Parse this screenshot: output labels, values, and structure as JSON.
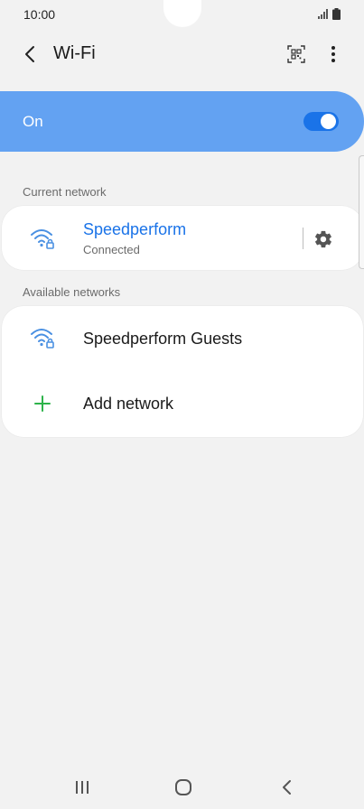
{
  "status_bar": {
    "time": "10:00",
    "signal_icon": "signal-bars-icon",
    "battery_icon": "battery-icon"
  },
  "app_bar": {
    "title": "Wi-Fi",
    "back_icon": "chevron-left-icon",
    "qr_icon": "qr-code-icon",
    "more_icon": "more-vertical-icon"
  },
  "master_toggle": {
    "label": "On",
    "state": "on",
    "background_color": "#63a2f2",
    "switch_color": "#1a73e8"
  },
  "current_network": {
    "header": "Current network",
    "name": "Speedperform",
    "status": "Connected",
    "name_color": "#1a73e8",
    "icon": "wifi-lock-icon",
    "settings_icon": "gear-icon"
  },
  "available_networks": {
    "header": "Available networks",
    "items": [
      {
        "name": "Speedperform Guests",
        "icon": "wifi-lock-icon"
      }
    ],
    "add_network": {
      "label": "Add network",
      "icon": "plus-icon",
      "icon_color": "#2db34a"
    }
  },
  "nav_bar": {
    "recents_icon": "recents-icon",
    "home_icon": "home-icon",
    "back_icon": "back-icon"
  }
}
